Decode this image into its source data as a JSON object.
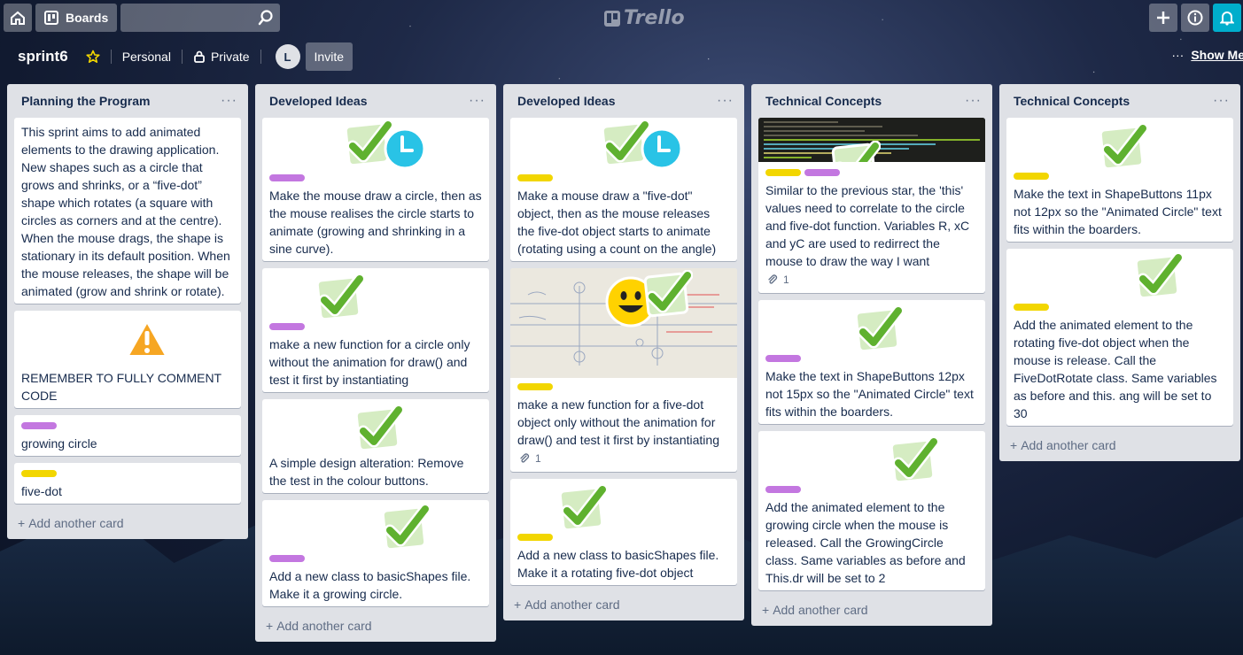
{
  "header": {
    "boards_label": "Boards",
    "search_placeholder": "",
    "logo_text": "Trello"
  },
  "board": {
    "title": "sprint6",
    "visibility_team": "Personal",
    "privacy": "Private",
    "avatar_initial": "L",
    "invite_label": "Invite",
    "show_menu_label": "Show Me"
  },
  "colors": {
    "label_purple": "#c377e0",
    "label_yellow": "#f2d600",
    "list_bg": "#dfe1e6",
    "bell_accent": "#00aecc"
  },
  "add_card_label": "Add another card",
  "lists": [
    {
      "title": "Planning the Program",
      "cards": [
        {
          "text": "This sprint aims to add animated elements to the drawing application. New shapes such as a circle that grows and shrinks, or a “five-dot” shape which rotates (a square with circles as corners and at the centre). When the mouse drags, the shape is stationary in its default position. When the mouse releases, the shape will be animated (grow and shrink or rotate)."
        },
        {
          "text": "REMEMBER TO FULLY COMMENT CODE",
          "sticker": "warning-icon"
        },
        {
          "label": "purple",
          "text": "growing circle"
        },
        {
          "label": "yellow",
          "text": "five-dot"
        }
      ]
    },
    {
      "title": "Developed Ideas",
      "cards": [
        {
          "label": "purple",
          "stickers": [
            "check-icon",
            "clock-icon"
          ],
          "text": "Make the mouse draw a circle, then as the mouse realises the circle starts to animate (growing and shrinking in a sine curve)."
        },
        {
          "label": "purple",
          "stickers": [
            "check-icon"
          ],
          "text": "make a new function for a circle only without the animation for draw() and test it first by instantiating"
        },
        {
          "stickers": [
            "check-icon"
          ],
          "text": "A simple design alteration: Remove the test in the colour buttons."
        },
        {
          "label": "purple",
          "stickers": [
            "check-icon"
          ],
          "text": "Add a new class to basicShapes file. Make it a growing circle."
        }
      ]
    },
    {
      "title": "Developed Ideas",
      "cards": [
        {
          "label": "yellow",
          "stickers": [
            "check-icon",
            "clock-icon"
          ],
          "text": "Make a mouse draw a \"five-dot\" object, then as the mouse releases the five-dot object starts to animate (rotating using a count on the angle)"
        },
        {
          "label": "yellow",
          "cover": "whiteboard",
          "text": "make a new function for a five-dot object only without the animation for draw() and test it first by instantiating",
          "attachments": "1"
        },
        {
          "label": "yellow",
          "stickers": [
            "check-icon"
          ],
          "text": "Add a new class to basicShapes file. Make it a rotating five-dot object"
        }
      ]
    },
    {
      "title": "Technical Concepts",
      "cards": [
        {
          "cover": "code",
          "labels": [
            "yellow",
            "purple"
          ],
          "text": "Similar to the previous star, the 'this' values need to correlate to the circle and five-dot function. Variables R, xC and yC are used to redirrect the mouse to draw the way I want",
          "attachments": "1"
        },
        {
          "label": "purple",
          "stickers": [
            "check-icon"
          ],
          "text": "Make the text in ShapeButtons 12px not 15px so the \"Animated Circle\" text fits within the boarders."
        },
        {
          "label": "purple",
          "stickers": [
            "check-icon"
          ],
          "text": "Add the animated element to the growing circle when the mouse is released. Call the GrowingCircle class. Same variables as before and This.dr will be set to 2"
        }
      ]
    },
    {
      "title": "Technical Concepts",
      "cards": [
        {
          "label": "yellow",
          "stickers": [
            "check-icon"
          ],
          "text": "Make the text in ShapeButtons 11px not 12px so the \"Animated Circle\" text fits within the boarders."
        },
        {
          "label": "yellow",
          "stickers": [
            "check-icon"
          ],
          "text": "Add the animated element to the rotating five-dot object when the mouse is release. Call the FiveDotRotate class. Same variables as before and this. ang will be set to 30"
        }
      ]
    }
  ]
}
